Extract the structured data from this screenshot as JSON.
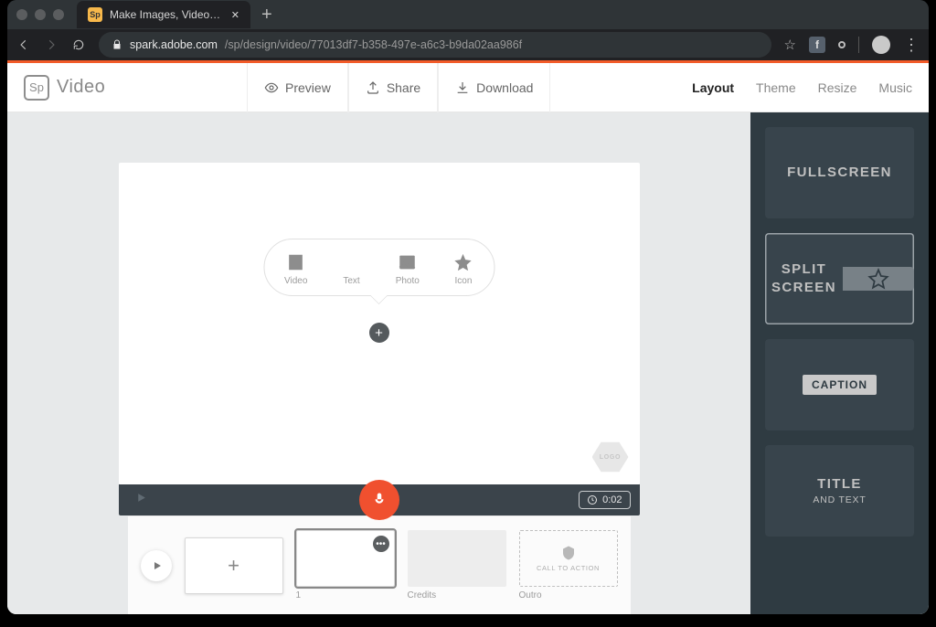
{
  "chrome": {
    "tab_title": "Make Images, Videos and Web",
    "favicon": "Sp",
    "url_host": "spark.adobe.com",
    "url_path": "/sp/design/video/77013df7-b358-497e-a6c3-b9da02aa986f"
  },
  "header": {
    "logo_badge": "Sp",
    "app_name": "Video",
    "preview": "Preview",
    "share": "Share",
    "download": "Download",
    "tabs": {
      "layout": "Layout",
      "theme": "Theme",
      "resize": "Resize",
      "music": "Music"
    }
  },
  "popover": {
    "video": "Video",
    "text": "Text",
    "photo": "Photo",
    "icon": "Icon"
  },
  "canvas": {
    "logo_placeholder": "LOGO",
    "duration": "0:02"
  },
  "filmstrip": {
    "slide_number": "1",
    "credits": "Credits",
    "outro": "Outro",
    "cta": "CALL TO ACTION"
  },
  "layouts": {
    "fullscreen": "FULLSCREEN",
    "split_top": "SPLIT",
    "split_bottom": "SCREEN",
    "caption": "CAPTION",
    "title_top": "TITLE",
    "title_bottom": "AND TEXT"
  }
}
